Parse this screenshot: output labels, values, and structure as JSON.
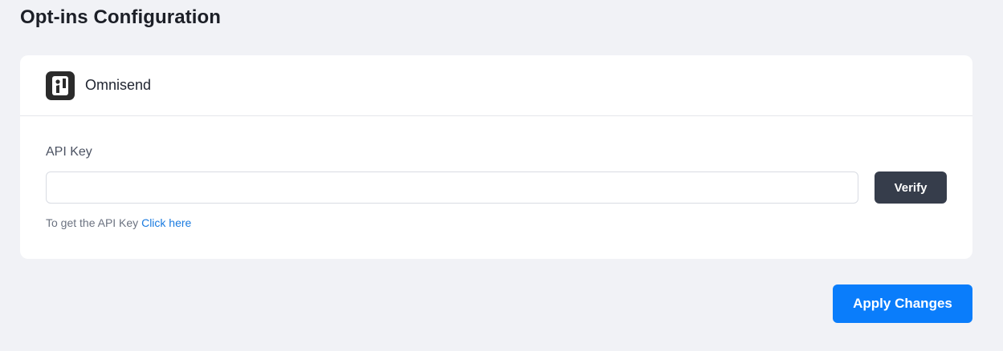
{
  "page": {
    "title": "Opt-ins Configuration"
  },
  "provider": {
    "name": "Omnisend",
    "logo_icon": "omnisend-logo-icon"
  },
  "api_key": {
    "label": "API Key",
    "value": "",
    "placeholder": "",
    "verify_label": "Verify"
  },
  "help": {
    "text": "To get the API Key",
    "link_label": "Click here"
  },
  "footer": {
    "apply_label": "Apply Changes"
  },
  "colors": {
    "background": "#f1f2f6",
    "card": "#ffffff",
    "verify_button": "#363d4b",
    "apply_button": "#0a7dfb",
    "link": "#1a7be0"
  }
}
